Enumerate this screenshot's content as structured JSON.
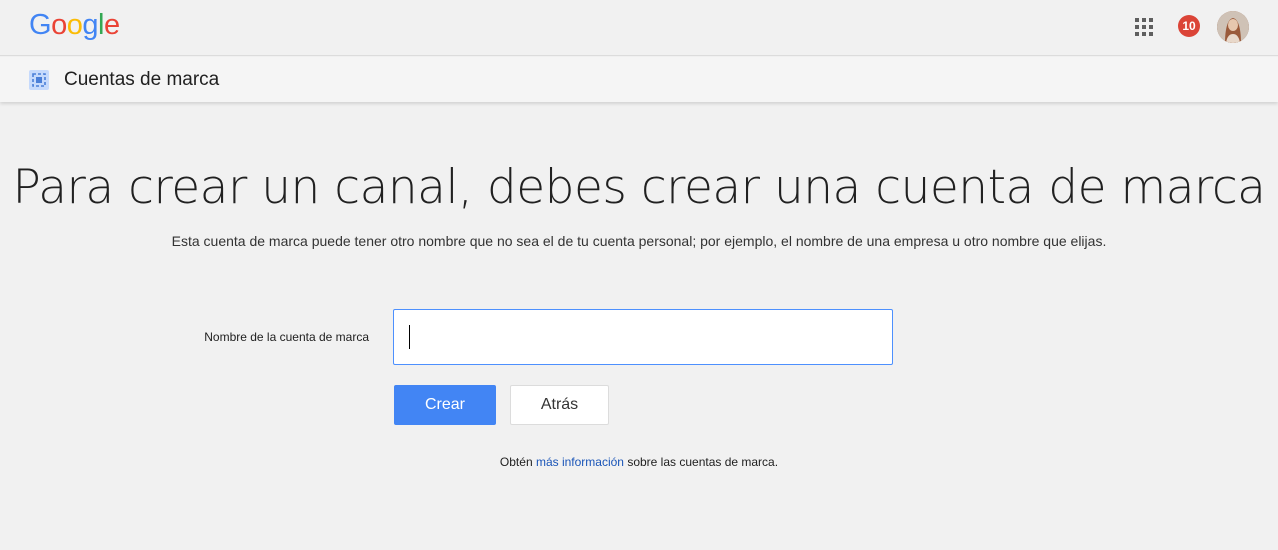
{
  "header": {
    "logo": {
      "letters": [
        "G",
        "o",
        "o",
        "g",
        "l",
        "e"
      ],
      "colors": [
        "#4285f4",
        "#ea4335",
        "#fbbc05",
        "#4285f4",
        "#34a853",
        "#ea4335"
      ]
    },
    "apps_icon": "apps-grid-icon",
    "notifications_count": "10",
    "notifications_color": "#db4437",
    "avatar_icon": "avatar"
  },
  "subheader": {
    "icon": "brand-account-icon",
    "title": "Cuentas de marca"
  },
  "main": {
    "headline": "Para crear un canal, debes crear una cuenta de marca",
    "description": "Esta cuenta de marca puede tener otro nombre que no sea el de tu cuenta personal; por ejemplo, el nombre de una empresa u otro nombre que elijas.",
    "form": {
      "label": "Nombre de la cuenta de marca",
      "value": "",
      "focused": true
    },
    "buttons": {
      "create": "Crear",
      "back": "Atrás"
    },
    "info": {
      "prefix": "Obtén ",
      "link": "más información",
      "suffix": " sobre las cuentas de marca."
    }
  },
  "colors": {
    "accent": "#4285f4",
    "link": "#1a55b8",
    "background": "#f1f1f1"
  }
}
